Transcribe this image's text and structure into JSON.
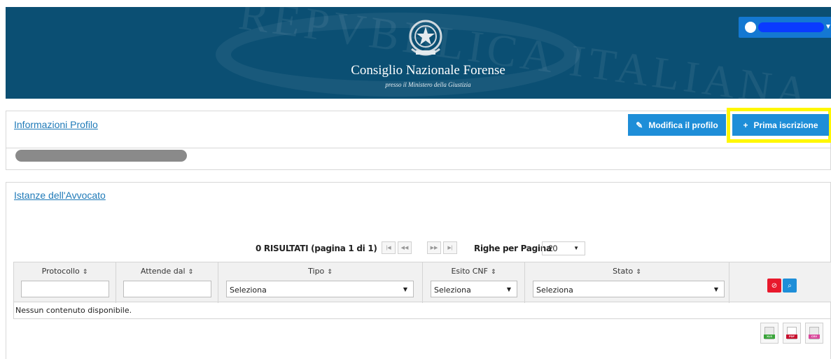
{
  "header": {
    "title": "Consiglio Nazionale Forense",
    "subtitle": "presso il Ministero della Giustizia",
    "watermark": "REPVBBLICA ITALIANA"
  },
  "profile_panel": {
    "link_label": "Informazioni Profilo",
    "modify_button": "Modifica il profilo",
    "modify_icon": "pencil-icon",
    "prima_button": "Prima iscrizione",
    "prima_icon": "plus-icon",
    "highlight_color": "#fff700"
  },
  "istanze_panel": {
    "link_label": "Istanze dell'Avvocato",
    "results_text": "0 RISULTATI (pagina 1 di 1)",
    "rows_label": "Righe per Pagina",
    "rows_value": "20",
    "columns": [
      "Protocollo",
      "Attende dal",
      "Tipo",
      "Esito CNF",
      "Stato"
    ],
    "select_placeholder": "Seleziona",
    "empty_text": "Nessun contenuto disponibile.",
    "clear_icon": "clear-filter-icon",
    "search_icon": "search-icon",
    "export_labels": [
      "XLS",
      "PDF",
      "CSV"
    ]
  },
  "colors": {
    "header_bg": "#0b4f73",
    "button_blue": "#1e8ed8",
    "link": "#1f7ab8",
    "danger": "#e8192c"
  }
}
